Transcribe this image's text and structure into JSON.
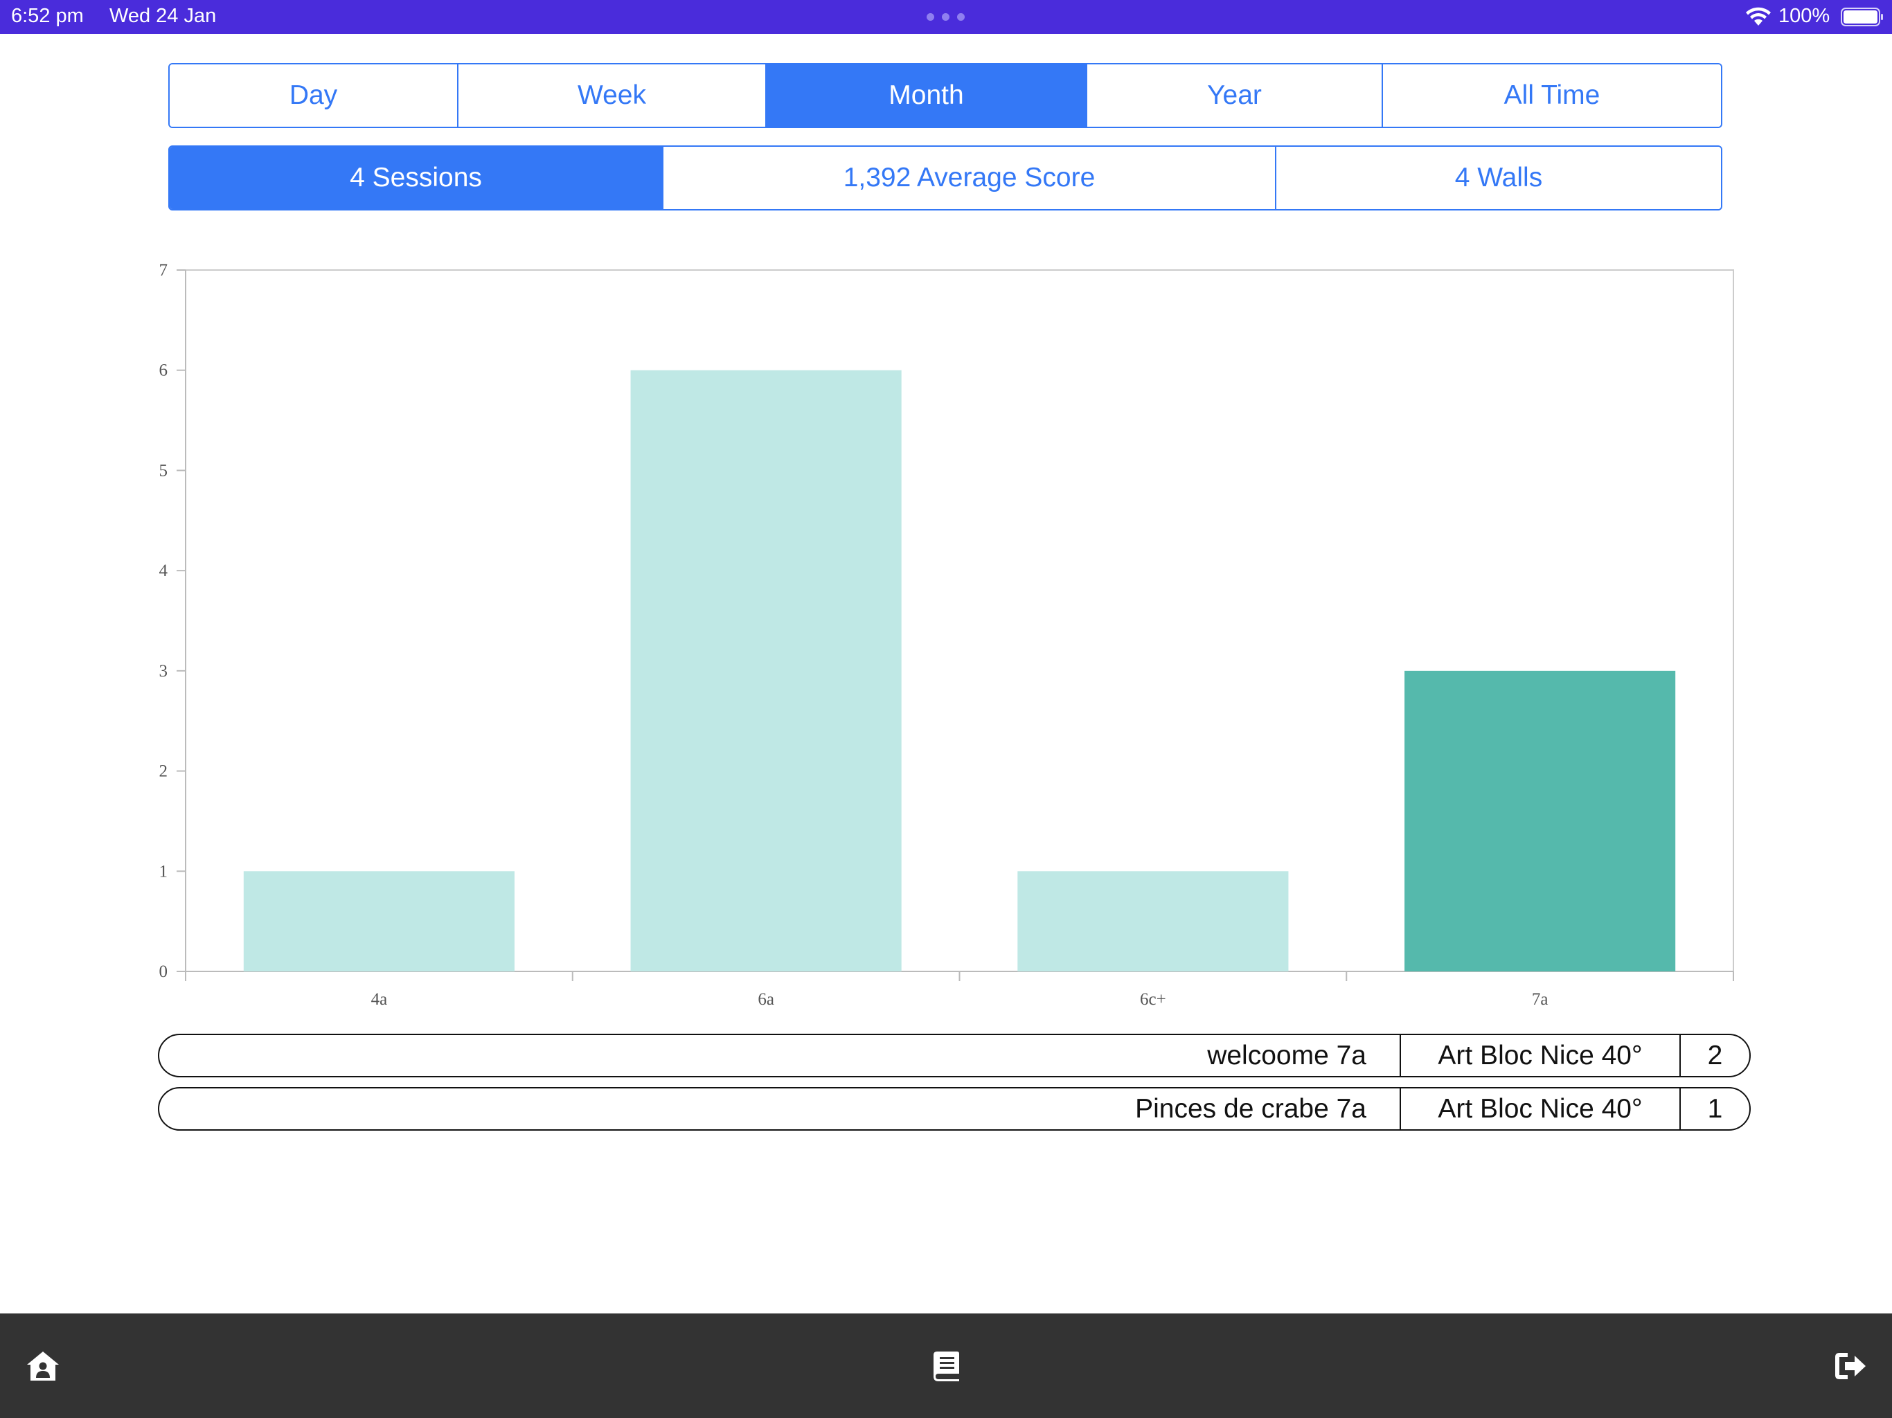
{
  "status": {
    "time": "6:52 pm",
    "date": "Wed 24 Jan",
    "battery": "100%",
    "icons": [
      "multitasking-dots-icon",
      "wifi-icon",
      "battery-icon"
    ]
  },
  "period_tabs": [
    {
      "label": "Day",
      "active": false
    },
    {
      "label": "Week",
      "active": false
    },
    {
      "label": "Month",
      "active": true
    },
    {
      "label": "Year",
      "active": false
    },
    {
      "label": "All Time",
      "active": false
    }
  ],
  "stat_tabs": [
    {
      "label": "4 Sessions",
      "active": true
    },
    {
      "label": "1,392 Average Score",
      "active": false
    },
    {
      "label": "4 Walls",
      "active": false
    }
  ],
  "chart_data": {
    "type": "bar",
    "categories": [
      "4a",
      "6a",
      "6c+",
      "7a"
    ],
    "values": [
      1,
      6,
      1,
      3
    ],
    "selected_category": "7a",
    "ylim": [
      0,
      7
    ],
    "yticks": [
      0,
      1,
      2,
      3,
      4,
      5,
      6,
      7
    ],
    "grid": false,
    "colors": {
      "bar": "#bfe8e5",
      "selected_bar": "#55b9ac",
      "axis": "#bbbbbb",
      "tick_label": "#555555"
    }
  },
  "routes": [
    {
      "name": "welcoome 7a",
      "wall": "Art Bloc Nice 40°",
      "count": "2"
    },
    {
      "name": "Pinces de crabe 7a",
      "wall": "Art Bloc Nice 40°",
      "count": "1"
    }
  ],
  "toolbar": {
    "buttons": [
      "home-icon",
      "book-icon",
      "logout-icon"
    ]
  },
  "colors": {
    "status_bar": "#4a2cdb",
    "accent": "#3478f6",
    "toolbar_bg": "#333333"
  }
}
